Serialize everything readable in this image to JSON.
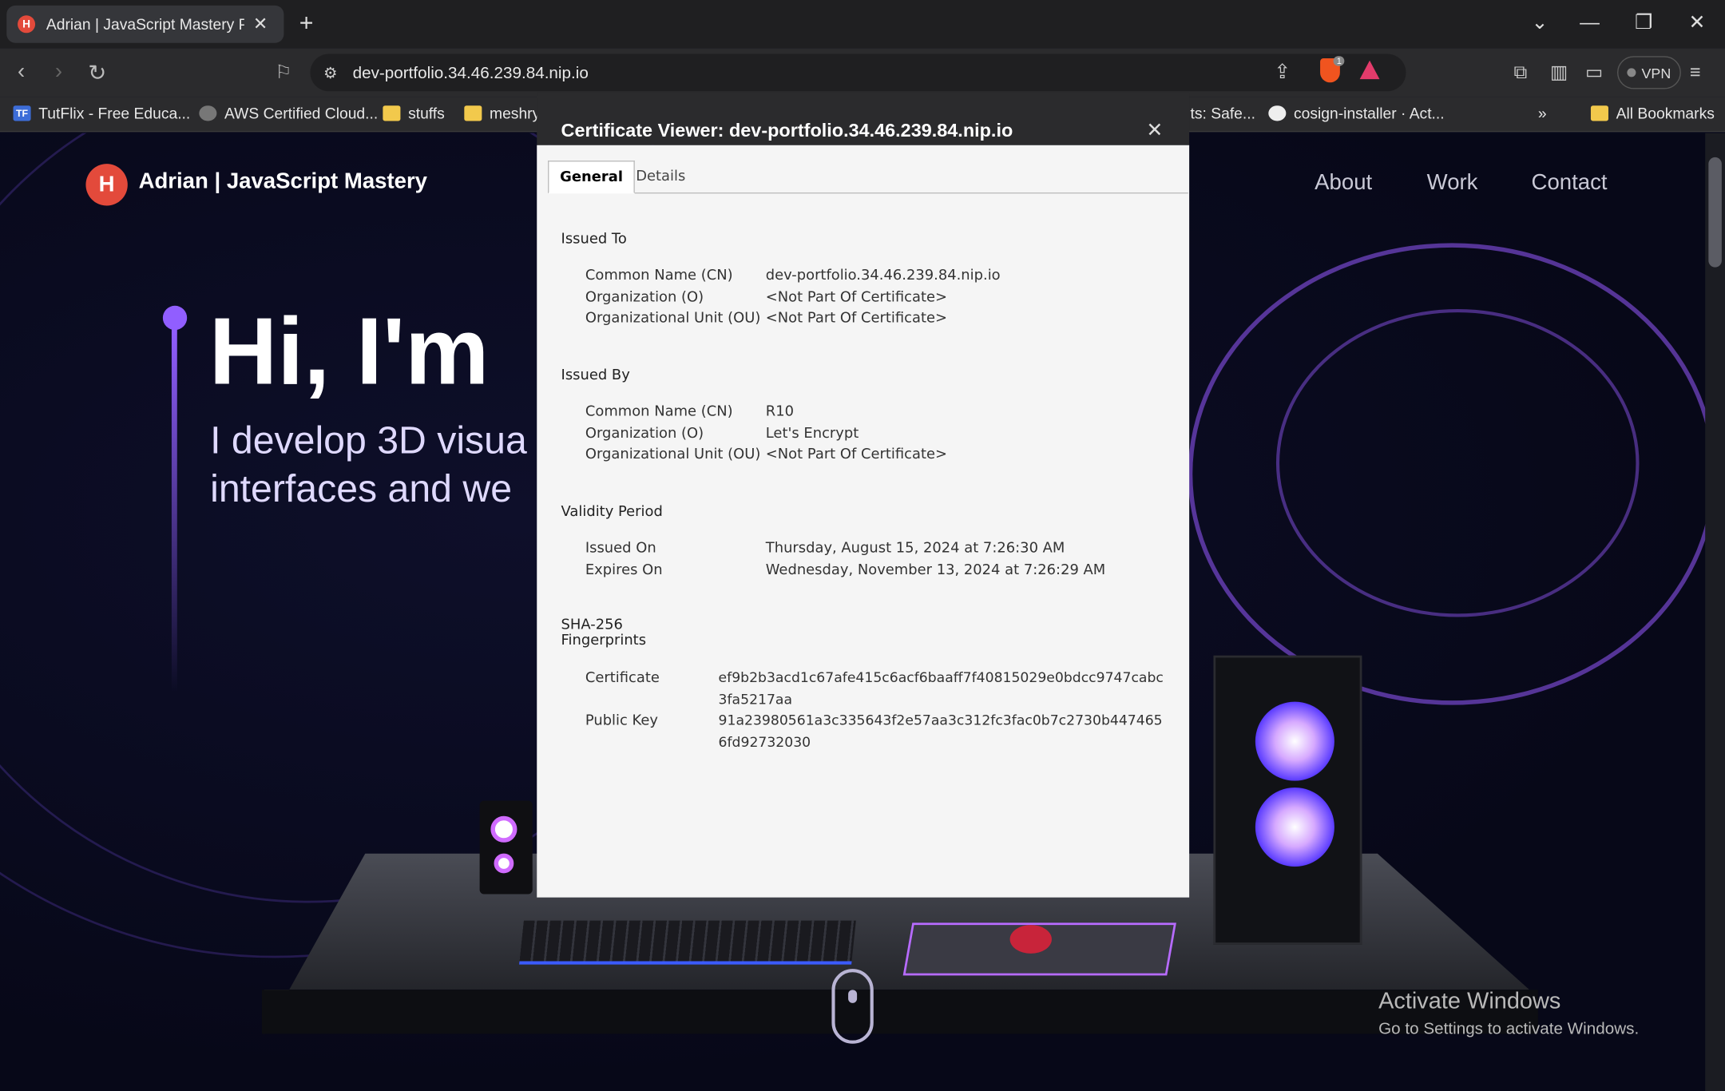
{
  "browser": {
    "tab_title": "Adrian | JavaScript Mastery Portfolio",
    "tab_favicon_letter": "H",
    "url": "dev-portfolio.34.46.239.84.nip.io",
    "vpn_label": "VPN",
    "shield_count": "1"
  },
  "bookmarks": [
    {
      "label": "TutFlix - Free Educa...",
      "icon": "TF"
    },
    {
      "label": "AWS Certified Cloud...",
      "icon": "globe"
    },
    {
      "label": "stuffs",
      "icon": "folder"
    },
    {
      "label": "meshry",
      "icon": "folder"
    },
    {
      "label": "ts: Safe...",
      "icon": "none"
    },
    {
      "label": "cosign-installer · Act...",
      "icon": "github"
    },
    {
      "label": "All Bookmarks",
      "icon": "folder"
    }
  ],
  "page": {
    "logo_letter": "H",
    "brand": "Adrian  | JavaScript Mastery",
    "nav": [
      "About",
      "Work",
      "Contact"
    ],
    "hero_title": "Hi, I'm",
    "hero_sub_1": "I develop 3D visua",
    "hero_sub_2": "interfaces and we",
    "activate_title": "Activate Windows",
    "activate_sub": "Go to Settings to activate Windows."
  },
  "dialog": {
    "title": "Certificate Viewer: dev-portfolio.34.46.239.84.nip.io",
    "tabs": [
      "General",
      "Details"
    ],
    "issued_to": {
      "heading": "Issued To",
      "rows": [
        {
          "label": "Common Name (CN)",
          "value": "dev-portfolio.34.46.239.84.nip.io"
        },
        {
          "label": "Organization (O)",
          "value": "<Not Part Of Certificate>"
        },
        {
          "label": "Organizational Unit (OU)",
          "value": "<Not Part Of Certificate>"
        }
      ]
    },
    "issued_by": {
      "heading": "Issued By",
      "rows": [
        {
          "label": "Common Name (CN)",
          "value": "R10"
        },
        {
          "label": "Organization (O)",
          "value": "Let's Encrypt"
        },
        {
          "label": "Organizational Unit (OU)",
          "value": "<Not Part Of Certificate>"
        }
      ]
    },
    "validity": {
      "heading": "Validity Period",
      "rows": [
        {
          "label": "Issued On",
          "value": "Thursday, August 15, 2024 at 7:26:30 AM"
        },
        {
          "label": "Expires On",
          "value": "Wednesday, November 13, 2024 at 7:26:29 AM"
        }
      ]
    },
    "fingerprints": {
      "heading_1": "SHA-256",
      "heading_2": "Fingerprints",
      "rows": [
        {
          "label": "Certificate",
          "value": "ef9b2b3acd1c67afe415c6acf6baaff7f40815029e0bdcc9747cabc3fa5217aa"
        },
        {
          "label": "Public Key",
          "value": "91a23980561a3c335643f2e57aa3c312fc3fac0b7c2730b4474656fd92732030"
        }
      ]
    }
  },
  "colors": {
    "accent": "#915eff",
    "brand_red": "#e34a3b",
    "dialog_bg": "#f5f5f5"
  }
}
